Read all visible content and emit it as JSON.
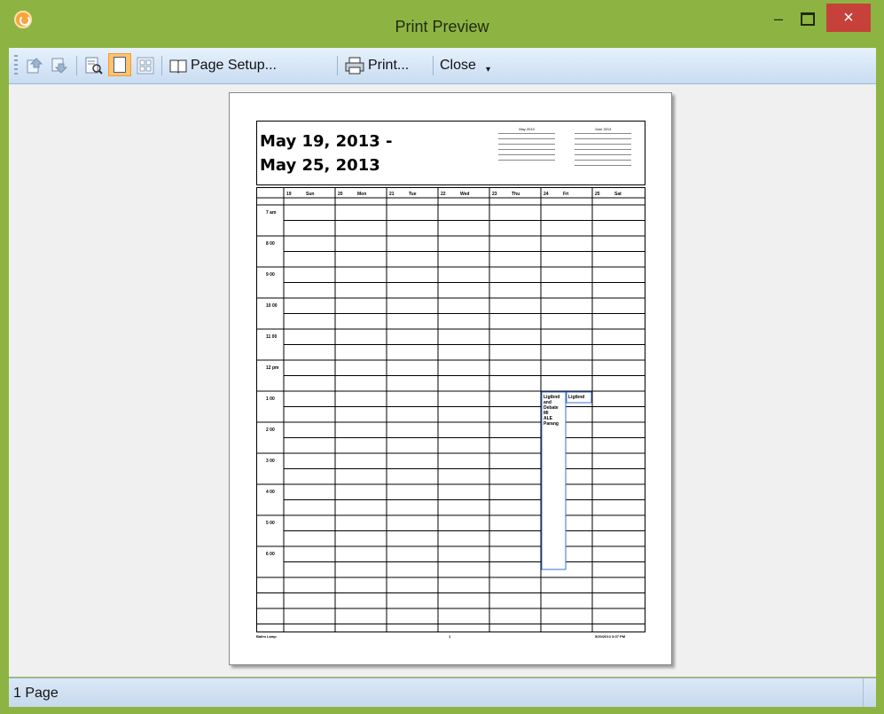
{
  "window": {
    "title": "Print Preview",
    "minimize": "–",
    "maximize": "",
    "close": "×"
  },
  "toolbar": {
    "page_setup": "Page Setup...",
    "print": "Print...",
    "close": "Close"
  },
  "page": {
    "range_line1": "May 19, 2013 -",
    "range_line2": "May 25, 2013",
    "mini_cal_1_title": "May 2013",
    "mini_cal_2_title": "June 2013",
    "days": [
      {
        "num": "19",
        "name": "Sun"
      },
      {
        "num": "20",
        "name": "Mon"
      },
      {
        "num": "21",
        "name": "Tue"
      },
      {
        "num": "22",
        "name": "Wed"
      },
      {
        "num": "23",
        "name": "Thu"
      },
      {
        "num": "24",
        "name": "Fri"
      },
      {
        "num": "25",
        "name": "Sat"
      }
    ],
    "times": [
      "7 am",
      "8 00",
      "9 00",
      "10 00",
      "11 00",
      "12 pm",
      "1 00",
      "2 00",
      "3 00",
      "4 00",
      "5 00",
      "6 00"
    ],
    "event_1": "Ligtbnd and Debate MI ALE Parang",
    "event_2": "Ligtbnd",
    "footer_left": "Balim Lamp",
    "footer_center": "1",
    "footer_right": "5/20/2013 3:07 PM"
  },
  "status": {
    "pages": "1 Page"
  }
}
